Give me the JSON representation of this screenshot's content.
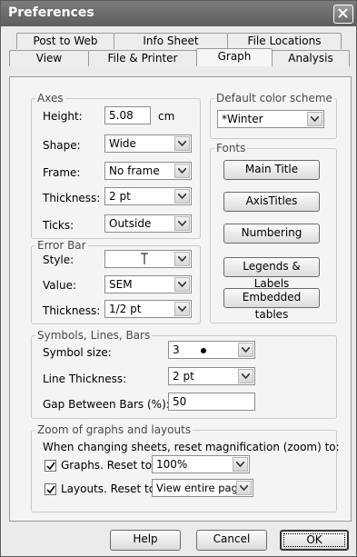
{
  "window": {
    "title": "Preferences"
  },
  "tabs": {
    "back": [
      "Post to Web",
      "Info Sheet",
      "File Locations"
    ],
    "front": [
      "View",
      "File & Printer",
      "Graph",
      "Analysis"
    ],
    "active": "Graph"
  },
  "axes": {
    "legend": "Axes",
    "height_label": "Height:",
    "height_value": "5.08",
    "height_unit": "cm",
    "shape_label": "Shape:",
    "shape_value": "Wide",
    "frame_label": "Frame:",
    "frame_value": "No frame",
    "thickness_label": "Thickness:",
    "thickness_value": "2 pt",
    "ticks_label": "Ticks:",
    "ticks_value": "Outside"
  },
  "errorbar": {
    "legend": "Error Bar",
    "style_label": "Style:",
    "value_label": "Value:",
    "value_value": "SEM",
    "thickness_label": "Thickness:",
    "thickness_value": "1/2 pt"
  },
  "colorscheme": {
    "legend": "Default color scheme",
    "value": "*Winter"
  },
  "fonts": {
    "legend": "Fonts",
    "main_title": "Main Title",
    "axis_titles": "AxisTitles",
    "numbering": "Numbering",
    "legends_labels": "Legends & Labels",
    "embedded_tables": "Embedded tables"
  },
  "symbols": {
    "legend": "Symbols, Lines, Bars",
    "size_label": "Symbol size:",
    "size_value": "3",
    "line_label": "Line Thickness:",
    "line_value": "2 pt",
    "gap_label": "Gap Between Bars (%):",
    "gap_value": "50"
  },
  "zoom": {
    "legend": "Zoom of graphs and layouts",
    "description": "When changing sheets, reset magnification (zoom) to:",
    "graphs_label": "Graphs. Reset to",
    "graphs_checked": true,
    "graphs_value": "100%",
    "layouts_label": "Layouts. Reset to",
    "layouts_checked": true,
    "layouts_value": "View entire page"
  },
  "buttons": {
    "help": "Help",
    "cancel": "Cancel",
    "ok": "OK"
  }
}
